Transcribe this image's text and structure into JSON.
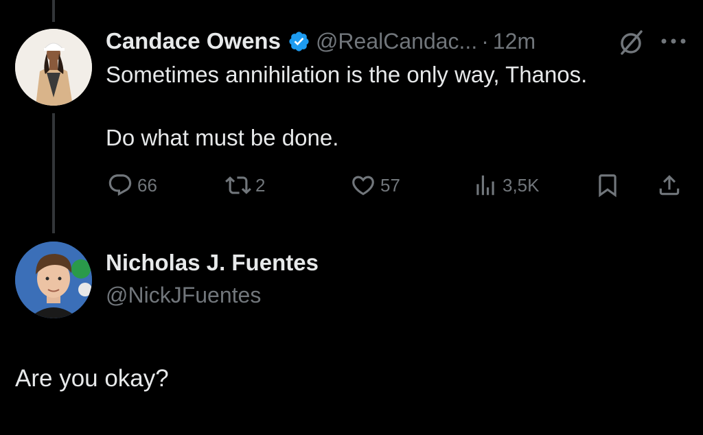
{
  "tweet": {
    "author": {
      "display_name": "Candace Owens",
      "handle": "@RealCandac...",
      "verified": true,
      "avatar_icon": "avatar-woman-white-cap"
    },
    "separator": "·",
    "time": "12m",
    "text_paragraphs": [
      "Sometimes annihilation is the only way, Thanos.",
      "Do what must be done."
    ],
    "actions": {
      "reply_count": "66",
      "retweet_count": "2",
      "like_count": "57",
      "views_count": "3,5K"
    },
    "icons": [
      "grok-icon",
      "more-icon",
      "reply-icon",
      "retweet-icon",
      "like-icon",
      "views-icon",
      "bookmark-icon",
      "share-icon"
    ]
  },
  "reply": {
    "author": {
      "display_name": "Nicholas J. Fuentes",
      "handle": "@NickJFuentes",
      "avatar_icon": "avatar-man-brown-hair"
    },
    "text": "Are you okay?"
  },
  "colors": {
    "background": "#000000",
    "primary_text": "#e7e9ea",
    "secondary_text": "#71767b",
    "verified_badge": "#1d9bf0",
    "thread_line": "#333639"
  }
}
